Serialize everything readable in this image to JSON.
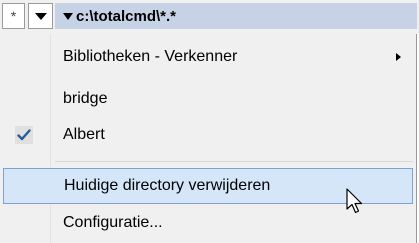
{
  "toolbar": {
    "star_label": "*",
    "path": "c:\\totalcmd\\*.*"
  },
  "menu": {
    "items": [
      {
        "label": "Bibliotheken - Verkenner",
        "submenu": true
      },
      {
        "label": "bridge"
      },
      {
        "label": "Albert",
        "checked": true
      },
      {
        "label": "Huidige directory verwijderen",
        "hovered": true
      },
      {
        "label": "Configuratie..."
      }
    ]
  },
  "icons": {
    "star": "asterisk-icon",
    "dropdown": "dropdown-arrow-icon",
    "submenu": "submenu-arrow-icon",
    "check": "checkmark-icon",
    "cursor": "mouse-pointer-icon"
  },
  "colors": {
    "path_bar": "#c6d2e6",
    "hover_fill": "#d5e6f9",
    "hover_border": "#7da2ce",
    "check": "#2a5d96"
  }
}
